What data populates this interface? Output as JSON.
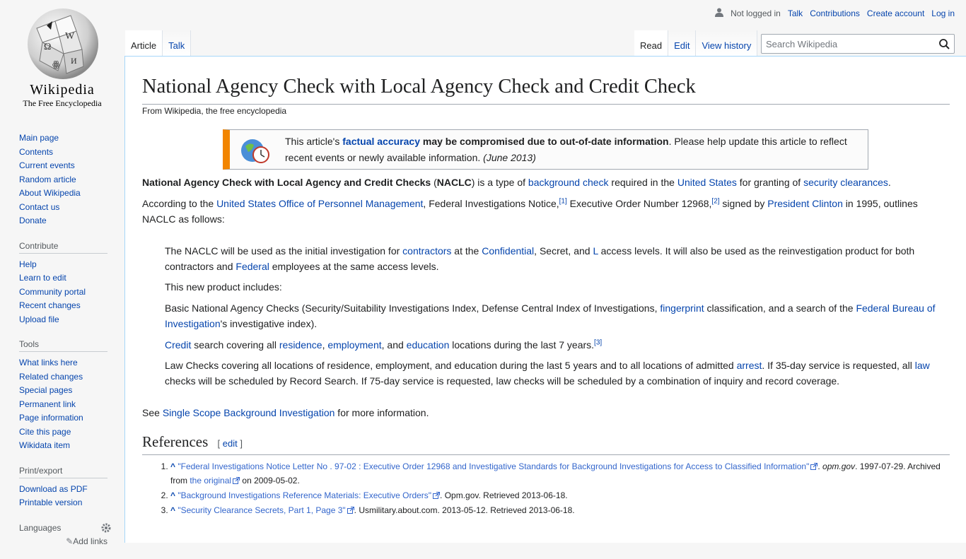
{
  "logo": {
    "wordmark": "Wikipedia",
    "tagline": "The Free Encyclopedia"
  },
  "personal": {
    "not_logged_in": "Not logged in",
    "talk": "Talk",
    "contributions": "Contributions",
    "create_account": "Create account",
    "login": "Log in"
  },
  "tabs": {
    "article": "Article",
    "talk": "Talk",
    "read": "Read",
    "edit": "Edit",
    "history": "View history"
  },
  "search": {
    "placeholder": "Search Wikipedia"
  },
  "sidebar": {
    "main": [
      "Main page",
      "Contents",
      "Current events",
      "Random article",
      "About Wikipedia",
      "Contact us",
      "Donate"
    ],
    "contribute_title": "Contribute",
    "contribute": [
      "Help",
      "Learn to edit",
      "Community portal",
      "Recent changes",
      "Upload file"
    ],
    "tools_title": "Tools",
    "tools": [
      "What links here",
      "Related changes",
      "Special pages",
      "Permanent link",
      "Page information",
      "Cite this page",
      "Wikidata item"
    ],
    "print_title": "Print/export",
    "print": [
      "Download as PDF",
      "Printable version"
    ],
    "languages_title": "Languages",
    "add_links": "Add links"
  },
  "article": {
    "title": "National Agency Check with Local Agency Check and Credit Check",
    "tagline": "From Wikipedia, the free encyclopedia",
    "ambox": {
      "t1": "This article's ",
      "link": "factual accuracy",
      "t2": " may be compromised due to out-of-date information",
      "t3": ". Please help update this article to reflect recent events or newly available information. ",
      "date": "(June 2013)"
    },
    "p1": {
      "b1": "National Agency Check with Local Agency and Credit Checks",
      "t1": " (",
      "b2": "NACLC",
      "t2": ") is a type of ",
      "l1": "background check",
      "t3": " required in the ",
      "l2": "United States",
      "t4": " for granting of ",
      "l3": "security clearances",
      "t5": "."
    },
    "p2": {
      "t1": "According to the ",
      "l1": "United States Office of Personnel Management",
      "t2": ", Federal Investigations Notice,",
      "r1": "[1]",
      "t3": " Executive Order Number 12968,",
      "r2": "[2]",
      "t4": " signed by ",
      "l2": "President Clinton",
      "t5": " in 1995, outlines NACLC as follows:"
    },
    "q1": {
      "t1": "The NACLC will be used as the initial investigation for ",
      "l1": "contractors",
      "t2": " at the ",
      "l2": "Confidential",
      "t3": ", Secret, and ",
      "l3": "L",
      "t4": " access levels. It will also be used as the reinvestigation product for both contractors and ",
      "l4": "Federal",
      "t5": " employees at the same access levels."
    },
    "q2": "This new product includes:",
    "q3": {
      "t1": "Basic National Agency Checks (Security/Suitability Investigations Index, Defense Central Index of Investigations, ",
      "l1": "fingerprint",
      "t2": " classification, and a search of the ",
      "l2": "Federal Bureau of Investigation",
      "t3": "'s investigative index)."
    },
    "q4": {
      "l1": "Credit",
      "t1": " search covering all ",
      "l2": "residence",
      "t2": ", ",
      "l3": "employment",
      "t3": ", and ",
      "l4": "education",
      "t4": " locations during the last 7 years.",
      "r1": "[3]"
    },
    "q5": {
      "t1": "Law Checks covering all locations of residence, employment, and education during the last 5 years and to all locations of admitted ",
      "l1": "arrest",
      "t2": ". If 35-day service is requested, all ",
      "l2": "law",
      "t3": " checks will be scheduled by Record Search. If 75-day service is requested, law checks will be scheduled by a combination of inquiry and record coverage."
    },
    "see": {
      "t1": "See ",
      "l1": "Single Scope Background Investigation",
      "t2": " for more information."
    },
    "references_heading": "References",
    "edit_section": "edit",
    "references": [
      {
        "caret": "^",
        "link": "\"Federal Investigations Notice Letter No . 97-02 : Executive Order 12968 and Investigative Standards for Background Investigations for Access to Classified Information\"",
        "t1": ". ",
        "site": "opm.gov",
        "t2": ". 1997-07-29. Archived from ",
        "archive": "the original",
        "t3": " on 2009-05-02."
      },
      {
        "caret": "^",
        "link": "\"Background Investigations Reference Materials: Executive Orders\"",
        "t1": ". Opm.gov. Retrieved 2013-06-18."
      },
      {
        "caret": "^",
        "link": "\"Security Clearance Secrets, Part 1, Page 3\"",
        "t1": ". Usmilitary.about.com. 2013-05-12. Retrieved 2013-06-18."
      }
    ]
  },
  "colors": {
    "link": "#0645ad",
    "ambox_border": "#f28500",
    "content_border": "#a7d7f9"
  }
}
